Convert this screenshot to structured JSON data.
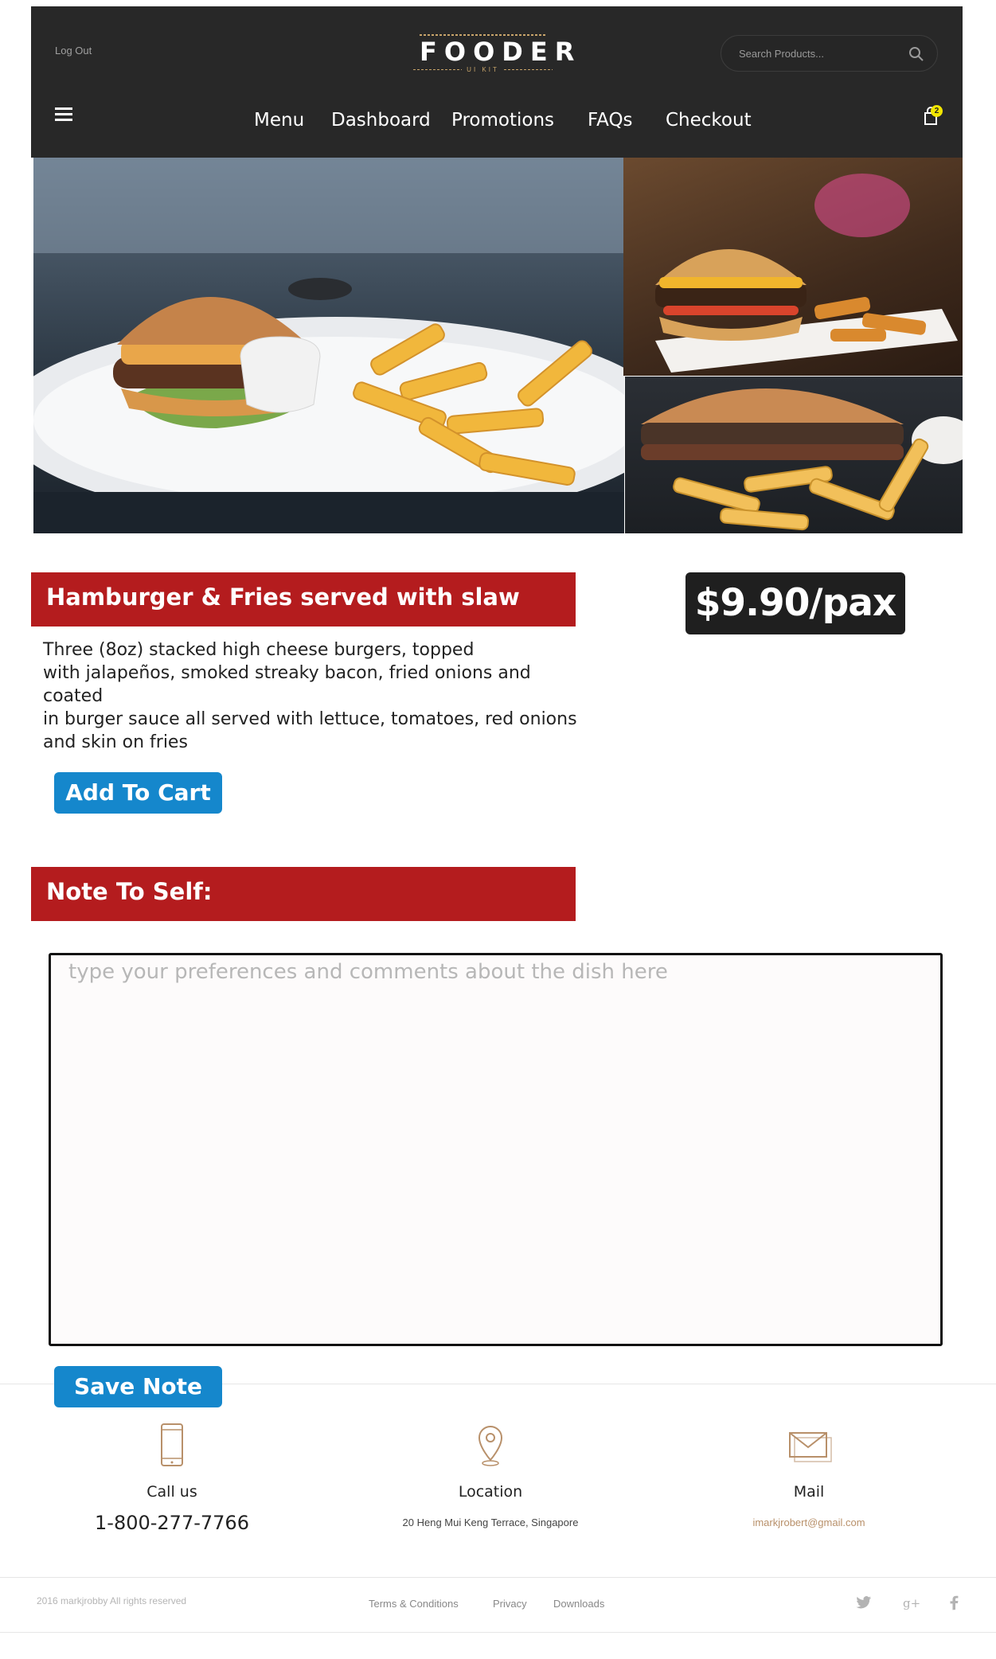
{
  "header": {
    "logout_label": "Log Out",
    "brand": "FOODER",
    "brand_sub": "UI KIT",
    "search_placeholder": "Search Products...",
    "cart_count": "2",
    "nav": [
      "Menu",
      "Dashboard",
      "Promotions",
      "FAQs",
      "Checkout"
    ]
  },
  "product": {
    "title": "Hamburger & Fries served with slaw",
    "price": "$9.90/pax",
    "description_lines": [
      "Three (8oz) stacked high cheese burgers, topped",
      "with jalapeños, smoked streaky bacon, fried onions and coated",
      "in burger sauce all served with lettuce, tomatoes, red onions",
      "and skin on fries"
    ],
    "add_to_cart_label": "Add To Cart"
  },
  "note": {
    "heading": "Note To Self:",
    "placeholder": "type your preferences and comments about the dish here",
    "save_label": "Save Note"
  },
  "footer": {
    "contacts": [
      {
        "label": "Call us",
        "value": "1-800-277-7766",
        "icon": "phone-icon"
      },
      {
        "label": "Location",
        "value": "20 Heng Mui Keng Terrace, Singapore",
        "icon": "location-pin-icon"
      },
      {
        "label": "Mail",
        "value": "imarkjrobert@gmail.com",
        "icon": "mail-icon"
      }
    ],
    "copyright": "2016 markjrobby All rights reserved",
    "links": [
      "Terms & Conditions",
      "Privacy",
      "Downloads"
    ],
    "social": [
      "twitter-icon",
      "google-plus-icon",
      "facebook-icon"
    ]
  },
  "colors": {
    "header_bg": "#282828",
    "accent_red": "#b41c1e",
    "accent_blue": "#1587cc",
    "badge_yellow": "#f2e600",
    "gold": "#c9a56a"
  }
}
